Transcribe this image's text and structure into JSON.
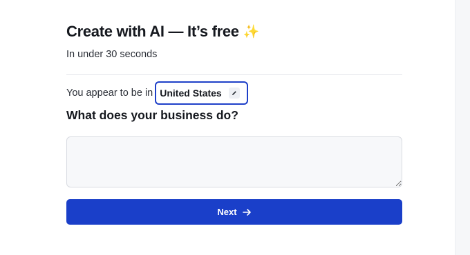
{
  "header": {
    "title": "Create with AI — It’s free",
    "title_icon": "sparkles-icon",
    "subtitle": "In under 30 seconds"
  },
  "location": {
    "prefix": "You appear to be in",
    "value": "United States",
    "edit_icon": "pencil-icon"
  },
  "business": {
    "question": "What does your business do?",
    "value": "",
    "placeholder": ""
  },
  "actions": {
    "next_label": "Next",
    "next_icon": "arrow-right-icon"
  },
  "colors": {
    "accent": "#1a3fc9",
    "chip_border": "#1d3fc8",
    "sparkle": "#f2c94c"
  }
}
